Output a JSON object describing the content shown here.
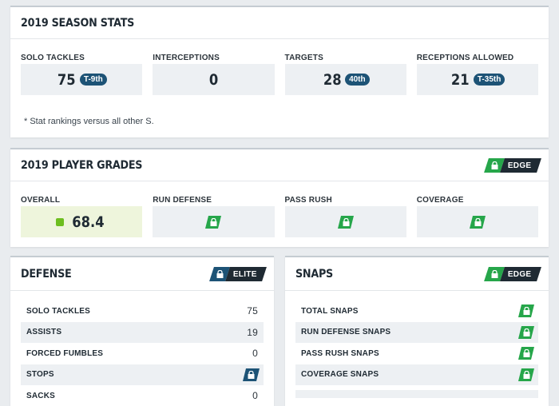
{
  "season_stats": {
    "title": "2019 SEASON STATS",
    "stats": [
      {
        "label": "SOLO TACKLES",
        "value": "75",
        "rank": "T-9th"
      },
      {
        "label": "INTERCEPTIONS",
        "value": "0",
        "rank": ""
      },
      {
        "label": "TARGETS",
        "value": "28",
        "rank": "40th"
      },
      {
        "label": "RECEPTIONS ALLOWED",
        "value": "21",
        "rank": "T-35th"
      }
    ],
    "note": "* Stat rankings versus all other S."
  },
  "player_grades": {
    "title": "2019 PLAYER GRADES",
    "badge": "EDGE",
    "overall_label": "OVERALL",
    "overall_value": "68.4",
    "locked": [
      {
        "label": "RUN DEFENSE"
      },
      {
        "label": "PASS RUSH"
      },
      {
        "label": "COVERAGE"
      }
    ]
  },
  "defense": {
    "title": "DEFENSE",
    "badge": "ELITE",
    "rows": [
      {
        "label": "SOLO TACKLES",
        "value": "75"
      },
      {
        "label": "ASSISTS",
        "value": "19"
      },
      {
        "label": "FORCED FUMBLES",
        "value": "0"
      },
      {
        "label": "STOPS",
        "value": ""
      },
      {
        "label": "SACKS",
        "value": "0"
      }
    ]
  },
  "snaps": {
    "title": "SNAPS",
    "badge": "EDGE",
    "rows": [
      {
        "label": "TOTAL SNAPS"
      },
      {
        "label": "RUN DEFENSE SNAPS"
      },
      {
        "label": "PASS RUSH SNAPS"
      },
      {
        "label": "COVERAGE SNAPS"
      }
    ]
  },
  "colors": {
    "accent_green": "#26a64a",
    "accent_navy": "#1d5376",
    "grade_dot": "#6dbe1f"
  },
  "icons": {
    "lock": "lock-icon",
    "grade": "grade-dot-icon"
  }
}
